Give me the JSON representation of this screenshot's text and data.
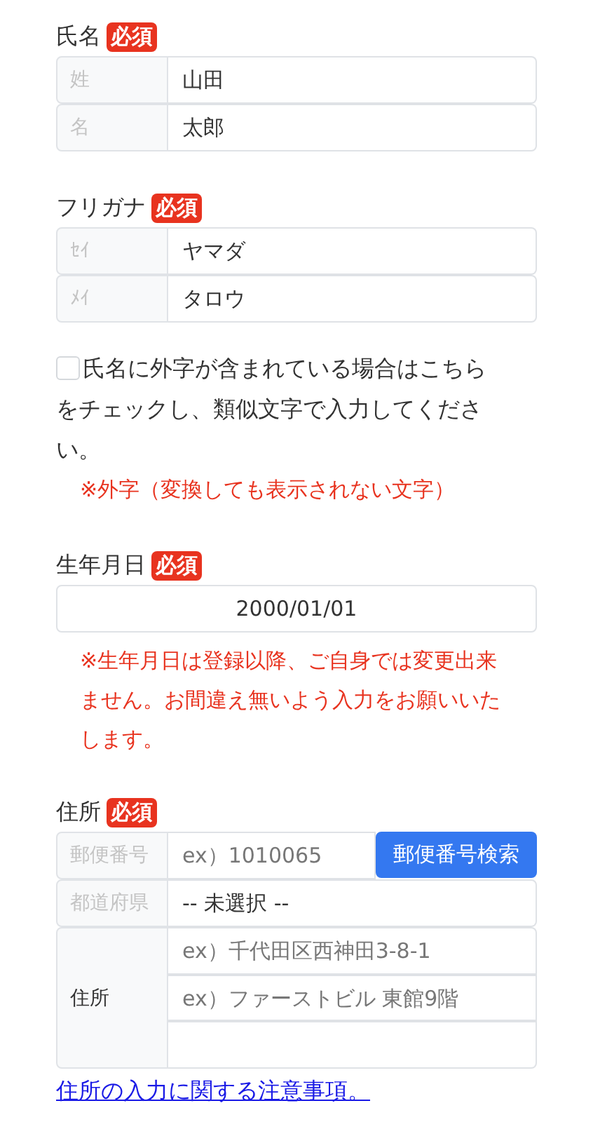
{
  "name": {
    "label": "氏名",
    "badge": "必須",
    "rows": [
      {
        "label": "姓",
        "value": "山田"
      },
      {
        "label": "名",
        "value": "太郎"
      }
    ]
  },
  "furigana": {
    "label": "フリガナ",
    "badge": "必須",
    "rows": [
      {
        "label": "ｾｲ",
        "value": "ヤマダ"
      },
      {
        "label": "ﾒｲ",
        "value": "タロウ"
      }
    ]
  },
  "gaiji": {
    "checked": false,
    "text": "氏名に外字が含まれている場合はこちらをチェックし、類似文字で入力してください。",
    "note": "※外字（変換しても表示されない文字）"
  },
  "birthdate": {
    "label": "生年月日",
    "badge": "必須",
    "value": "2000/01/01",
    "note": "※生年月日は登録以降、ご自身では変更出来ません。お間違え無いよう入力をお願いいたします。"
  },
  "address": {
    "label": "住所",
    "badge": "必須",
    "postal": {
      "label": "郵便番号",
      "placeholder": "ex）1010065",
      "button": "郵便番号検索"
    },
    "prefecture": {
      "label": "都道府県",
      "value": "-- 未選択 --"
    },
    "street": {
      "label": "住所",
      "placeholders": [
        "ex）千代田区西神田3-8-1",
        "ex）ファーストビル 東館9階"
      ]
    },
    "link": "住所の入力に関する注意事項。"
  }
}
